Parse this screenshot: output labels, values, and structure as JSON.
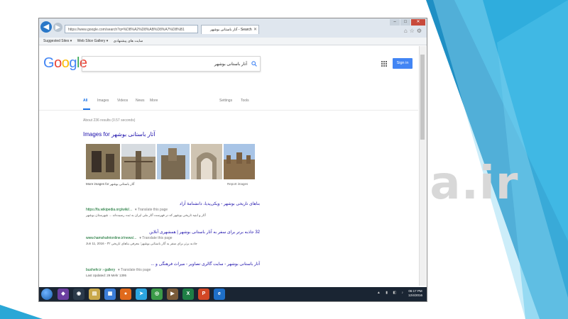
{
  "watermark": "Gama.ir",
  "browser": {
    "address_url": "https://www.google.com/search?q=%D8%A2%D8%AB%D8%A7%D8%B1",
    "tab_title": "آثار باستانی بوشهر - Search",
    "favorites": [
      "Suggested Sites ▾",
      "Web Slice Gallery ▾",
      "سایت های پیشنهادی"
    ],
    "window_buttons": [
      "–",
      "□",
      "✕"
    ]
  },
  "google": {
    "logo_letters": [
      "G",
      "o",
      "o",
      "g",
      "l",
      "e"
    ],
    "query": "آثار باستانی بوشهر",
    "signin": "Sign in",
    "tabs": [
      "All",
      "Images",
      "Videos",
      "News",
      "More",
      "Settings",
      "Tools"
    ],
    "stats": "About 236 results (0.57 seconds)",
    "images_heading": "Images for آثار باستانی بوشهر",
    "more_images": "More images for آثار باستانی بوشهر",
    "report_images": "Report images",
    "results": [
      {
        "title": "بناهای تاریخی بوشهر - ویکی‌پدیا، دانشنامهٔ آزاد",
        "url": "https://fa.wikipedia.org/wiki/...",
        "translate": "▾ Translate this page",
        "snippet": "آثار و ابنیه تاریخی بوشهر که در فهرست آثار ملی ایران به ثبت رسیده‌اند ... شهرستان بوشهر"
      },
      {
        "title": "32 جاذبه برتر برای سفر به آثار باستانی بوشهر | همشهری آنلاین",
        "url": "www.hamshahrionline.ir/news/...",
        "translate": "▾ Translate this page",
        "date": "Jun 11, 2016 -",
        "snippet": "۳۲ جاذبه برتر برای سفر به آثار باستانی بوشهر؛ معرفی بناهای تاریخی"
      },
      {
        "title": "آثار باستانی بوشهر - سایت گالری تصاویر - میراث فرهنگی و ...",
        "url": "bushehr.ir › gallery",
        "translate": "▾ Translate this page",
        "snippet": "Last Updated: 29 Mehr 1395"
      }
    ]
  },
  "taskbar": {
    "icons": [
      "start-icon",
      "vs-icon",
      "steam-icon",
      "explorer-icon",
      "dopus-icon",
      "firefox-icon",
      "telegram-icon",
      "chrome-icon",
      "media-icon",
      "excel-icon",
      "powerpoint-icon",
      "ie-icon"
    ],
    "time": "06:17 PM",
    "date": "12/4/2016"
  },
  "colors": {
    "google_blue": "#4285f4",
    "link": "#1a0dab",
    "url_green": "#006621",
    "slide_accent": "#2aa7d6"
  }
}
